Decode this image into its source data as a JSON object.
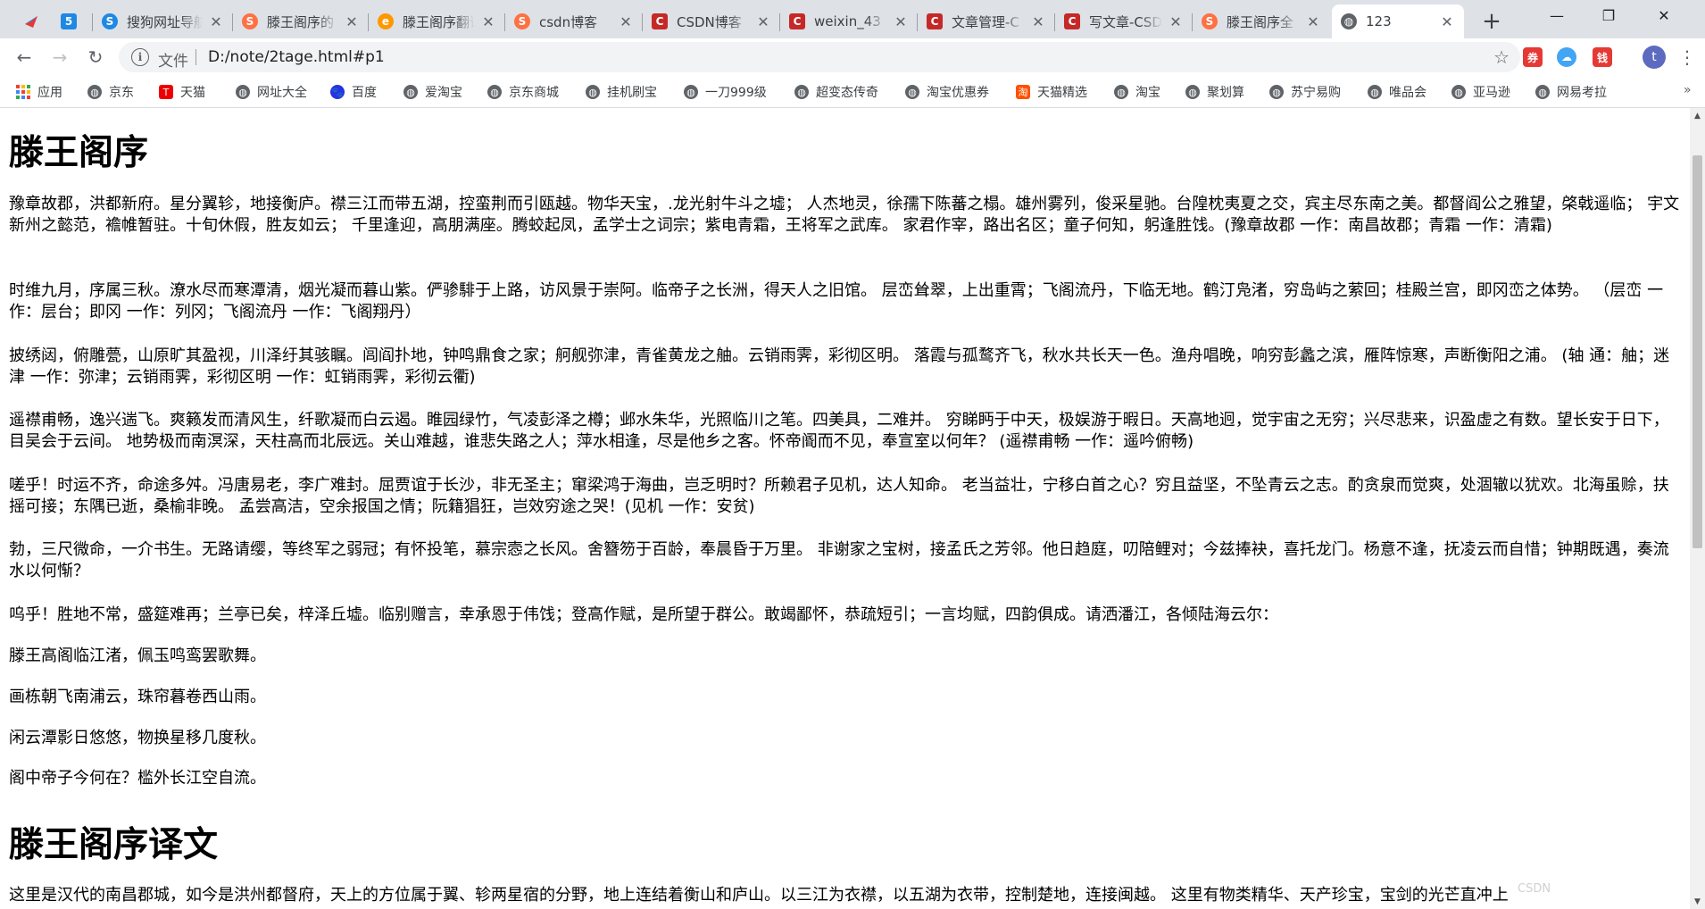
{
  "tabs": [
    {
      "title": "",
      "favicon": "red-arrow",
      "color": "#e53935"
    },
    {
      "title": "",
      "favicon": "five",
      "color": "#1e88e5"
    },
    {
      "title": "搜狗网址导航",
      "favicon": "S",
      "color": "#1e88e5"
    },
    {
      "title": "滕王阁序的",
      "favicon": "S",
      "color": "#ff7043"
    },
    {
      "title": "滕王阁序翻译",
      "favicon": "e",
      "color": "#ff9800"
    },
    {
      "title": "csdn博客",
      "favicon": "S",
      "color": "#ff7043"
    },
    {
      "title": "CSDN博客",
      "favicon": "C",
      "color": "#c62828"
    },
    {
      "title": "weixin_43",
      "favicon": "C",
      "color": "#c62828"
    },
    {
      "title": "文章管理-C",
      "favicon": "C",
      "color": "#c62828"
    },
    {
      "title": "写文章-CSD",
      "favicon": "C",
      "color": "#c62828"
    },
    {
      "title": "滕王阁序全",
      "favicon": "S",
      "color": "#ff7043"
    },
    {
      "title": "123",
      "favicon": "globe",
      "color": "#5f6368",
      "active": true
    }
  ],
  "window_controls": {
    "minimize": "—",
    "maximize": "❐",
    "close": "✕"
  },
  "toolbar": {
    "back": "←",
    "forward": "→",
    "reload": "↻",
    "omnibox_label": "文件",
    "url": "D:/note/2tage.html#p1",
    "star": "☆"
  },
  "extensions": [
    {
      "label": "券",
      "color": "#e53935"
    },
    {
      "label": "☁",
      "color": "#42a5f5"
    },
    {
      "label": "钱",
      "color": "#e53935"
    }
  ],
  "profile_initial": "t",
  "menu": "⋮",
  "bookmarks": [
    {
      "label": "应用",
      "icon": "apps"
    },
    {
      "label": "京东",
      "icon": "globe"
    },
    {
      "label": "天猫",
      "icon": "tmall"
    },
    {
      "label": "网址大全",
      "icon": "globe"
    },
    {
      "label": "百度",
      "icon": "baidu"
    },
    {
      "label": "爱淘宝",
      "icon": "globe"
    },
    {
      "label": "京东商城",
      "icon": "globe"
    },
    {
      "label": "挂机刷宝",
      "icon": "globe"
    },
    {
      "label": "一刀999级",
      "icon": "globe"
    },
    {
      "label": "超变态传奇",
      "icon": "globe"
    },
    {
      "label": "淘宝优惠券",
      "icon": "globe"
    },
    {
      "label": "天猫精选",
      "icon": "tmall-select"
    },
    {
      "label": "淘宝",
      "icon": "globe"
    },
    {
      "label": "聚划算",
      "icon": "globe"
    },
    {
      "label": "苏宁易购",
      "icon": "globe"
    },
    {
      "label": "唯品会",
      "icon": "globe"
    },
    {
      "label": "亚马逊",
      "icon": "globe"
    },
    {
      "label": "网易考拉",
      "icon": "globe"
    }
  ],
  "bookmarks_more": "»",
  "page": {
    "heading1": "滕王阁序",
    "paragraphs": [
      "豫章故郡，洪都新府。星分翼轸，地接衡庐。襟三江而带五湖，控蛮荆而引瓯越。物华天宝，.龙光射牛斗之墟； 人杰地灵，徐孺下陈蕃之榻。雄州雾列，俊采星驰。台隍枕夷夏之交，宾主尽东南之美。都督阎公之雅望，棨戟遥临； 宇文新州之懿范，襜帷暂驻。十旬休假，胜友如云； 千里逢迎，高朋满座。腾蛟起凤，孟学士之词宗；紫电青霜，王将军之武库。 家君作宰，路出名区；童子何知，躬逢胜饯。(豫章故郡 一作：南昌故郡；青霜 一作：清霜)",
      "时维九月，序属三秋。潦水尽而寒潭清，烟光凝而暮山紫。俨骖騑于上路，访风景于崇阿。临帝子之长洲，得天人之旧馆。 层峦耸翠，上出重霄；飞阁流丹，下临无地。鹤汀凫渚，穷岛屿之萦回；桂殿兰宫，即冈峦之体势。  （层峦 一作：层台；即冈 一作：列冈；飞阁流丹 一作：飞阁翔丹）",
      "披绣闼，俯雕甍，山原旷其盈视，川泽纡其骇瞩。闾阎扑地，钟鸣鼎食之家；舸舰弥津，青雀黄龙之舳。云销雨霁，彩彻区明。 落霞与孤鹜齐飞，秋水共长天一色。渔舟唱晚，响穷彭蠡之滨，雁阵惊寒，声断衡阳之浦。 (轴 通：舳；迷津 一作：弥津；云销雨霁，彩彻区明 一作：虹销雨霁，彩彻云衢)",
      "遥襟甫畅，逸兴遄飞。爽籁发而清风生，纤歌凝而白云遏。睢园绿竹，气凌彭泽之樽；邺水朱华，光照临川之笔。四美具，二难并。 穷睇眄于中天，极娱游于暇日。天高地迥，觉宇宙之无穷；兴尽悲来，识盈虚之有数。望长安于日下，目吴会于云间。 地势极而南溟深，天柱高而北辰远。关山难越，谁悲失路之人；萍水相逢，尽是他乡之客。怀帝阍而不见，奉宣室以何年？ (遥襟甫畅 一作：遥吟俯畅)",
      "嗟乎！时运不齐，命途多舛。冯唐易老，李广难封。屈贾谊于长沙，非无圣主；窜梁鸿于海曲，岂乏明时？所赖君子见机，达人知命。 老当益壮，宁移白首之心？穷且益坚，不坠青云之志。酌贪泉而觉爽，处涸辙以犹欢。北海虽赊，扶摇可接；东隅已逝，桑榆非晚。 孟尝高洁，空余报国之情；阮籍猖狂，岂效穷途之哭！(见机 一作：安贫)",
      "勃，三尺微命，一介书生。无路请缨，等终军之弱冠；有怀投笔，慕宗悫之长风。舍簪笏于百龄，奉晨昏于万里。 非谢家之宝树，接孟氏之芳邻。他日趋庭，叨陪鲤对；今兹捧袂，喜托龙门。杨意不逢，抚凌云而自惜；钟期既遇，奏流水以何惭？",
      "呜乎！胜地不常，盛筵难再；兰亭已矣，梓泽丘墟。临别赠言，幸承恩于伟饯；登高作赋，是所望于群公。敢竭鄙怀，恭疏短引；一言均赋，四韵俱成。请洒潘江，各倾陆海云尔：",
      "滕王高阁临江渚，佩玉鸣鸾罢歌舞。",
      "画栋朝飞南浦云，珠帘暮卷西山雨。",
      "闲云潭影日悠悠，物换星移几度秋。",
      "阁中帝子今何在？槛外长江空自流。"
    ],
    "heading2": "滕王阁序译文",
    "translation_first": "这里是汉代的南昌郡城，如今是洪州都督府，天上的方位属于翼、轸两星宿的分野，地上连结着衡山和庐山。以三江为衣襟，以五湖为衣带，控制楚地，连接闽越。 这里有物类精华、天产珍宝，宝剑的光芒直冲上"
  },
  "watermark": "CSDN"
}
